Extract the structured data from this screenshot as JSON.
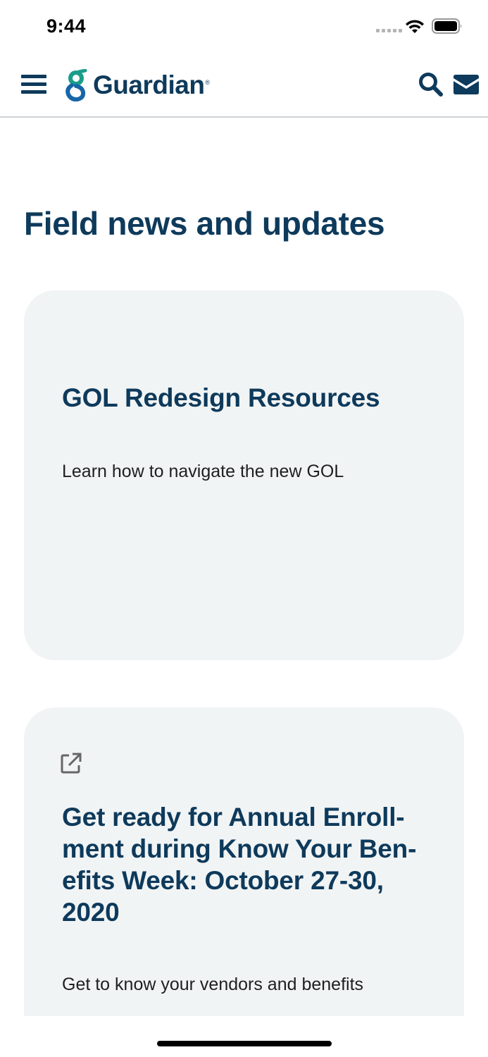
{
  "status_bar": {
    "time": "9:44"
  },
  "header": {
    "brand_name": "Guardian",
    "brand_mark": "®",
    "menu_icon": "hamburger-menu-icon",
    "search_icon": "search-icon",
    "mail_icon": "mail-icon"
  },
  "main": {
    "page_title": "Field news and updates",
    "cards": [
      {
        "title": "GOL Redesign Resources",
        "description": "Learn how to navigate the new GOL",
        "external": false
      },
      {
        "title": "Get ready for Annual Enroll-ment during Know Your Ben-efits Week: October 27-30, 2020",
        "description": "Get to know your vendors and benefits",
        "external": true,
        "external_icon": "external-link-icon"
      }
    ]
  },
  "colors": {
    "brand_navy": "#0e3a5b",
    "brand_teal": "#1a9e8a",
    "card_background": "#f1f4f5"
  }
}
